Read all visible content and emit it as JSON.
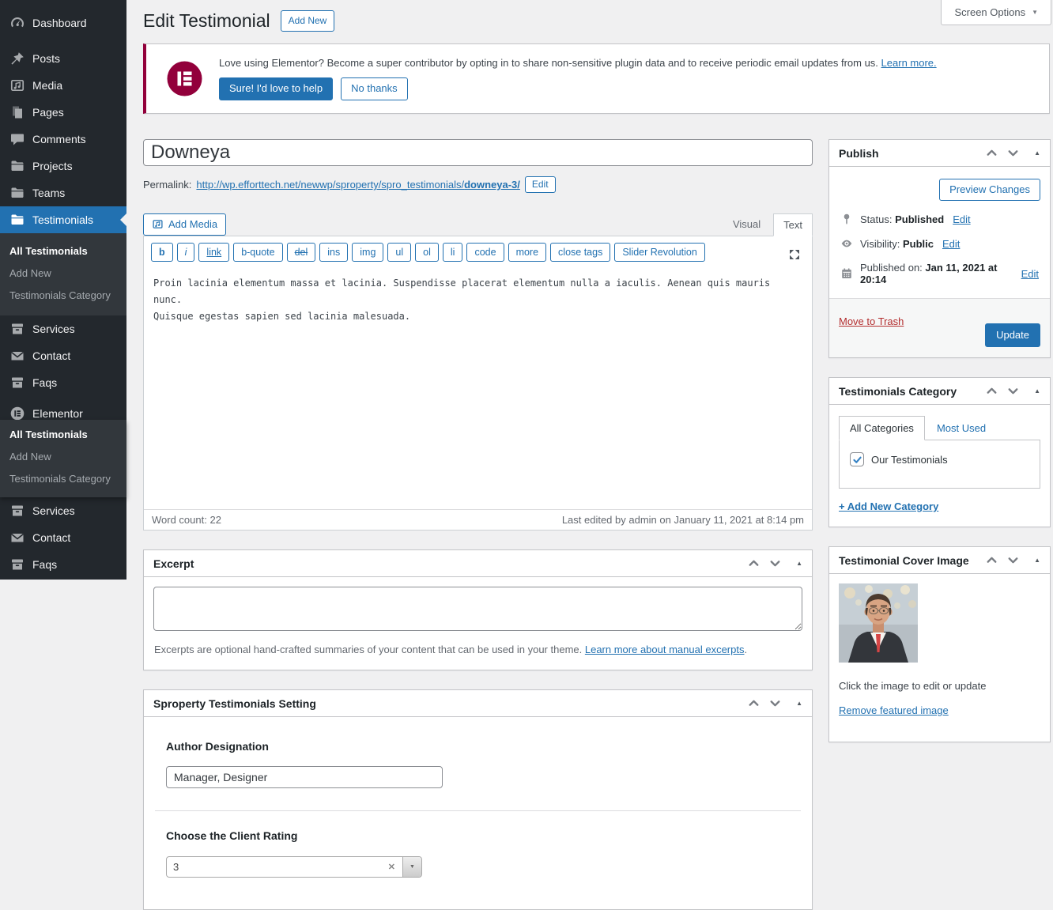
{
  "screen_options": {
    "label": "Screen Options"
  },
  "sidebar": {
    "dashboard": "Dashboard",
    "posts": "Posts",
    "media": "Media",
    "pages": "Pages",
    "comments": "Comments",
    "projects": "Projects",
    "teams": "Teams",
    "testimonials": "Testimonials",
    "submenu": {
      "all": "All Testimonials",
      "add": "Add New",
      "category": "Testimonials Category"
    },
    "services": "Services",
    "contact": "Contact",
    "faqs": "Faqs",
    "elementor": "Elementor",
    "flyout": {
      "all": "All Testimonials",
      "add": "Add New",
      "category": "Testimonials Category"
    },
    "services2": "Services",
    "contact2": "Contact",
    "faqs2": "Faqs"
  },
  "header": {
    "title": "Edit Testimonial",
    "add_new": "Add New"
  },
  "notice": {
    "message": "Love using Elementor? Become a super contributor by opting in to share non-sensitive plugin data and to receive periodic email updates from us. ",
    "learn_more": "Learn more.",
    "accept": "Sure! I'd love to help",
    "decline": "No thanks"
  },
  "post": {
    "title": "Downeya",
    "permalink_label": "Permalink:",
    "permalink_base": "http://wp.efforttech.net/newwp/sproperty/spro_testimonials/",
    "permalink_slug": "downeya-3/",
    "edit_button": "Edit"
  },
  "editor": {
    "add_media": "Add Media",
    "visual_tab": "Visual",
    "text_tab": "Text",
    "quicktags": [
      "b",
      "i",
      "link",
      "b-quote",
      "del",
      "ins",
      "img",
      "ul",
      "ol",
      "li",
      "code",
      "more",
      "close tags",
      "Slider Revolution"
    ],
    "content": "Proin lacinia elementum massa et lacinia. Suspendisse placerat elementum nulla a iaculis. Aenean quis mauris nunc.\nQuisque egestas sapien sed lacinia malesuada.",
    "word_count": "Word count: 22",
    "last_edited": "Last edited by admin on January 11, 2021 at 8:14 pm"
  },
  "excerpt": {
    "title": "Excerpt",
    "help_text": "Excerpts are optional hand-crafted summaries of your content that can be used in your theme. ",
    "help_link": "Learn more about manual excerpts",
    "help_period": "."
  },
  "settings": {
    "title": "Sproperty Testimonials Setting",
    "author_label": "Author Designation",
    "author_value": "Manager, Designer",
    "rating_label": "Choose the Client Rating",
    "rating_value": "3"
  },
  "publish": {
    "title": "Publish",
    "preview": "Preview Changes",
    "status_label": "Status:",
    "status_value": "Published",
    "visibility_label": "Visibility:",
    "visibility_value": "Public",
    "published_label": "Published on:",
    "published_value": "Jan 11, 2021 at 20:14",
    "edit": "Edit",
    "trash": "Move to Trash",
    "update": "Update"
  },
  "category_box": {
    "title": "Testimonials Category",
    "tab_all": "All Categories",
    "tab_most_used": "Most Used",
    "item": "Our Testimonials",
    "add_new": "+ Add New Category"
  },
  "cover_box": {
    "title": "Testimonial Cover Image",
    "hint": "Click the image to edit or update",
    "remove": "Remove featured image"
  },
  "colors": {
    "accent": "#2271b1",
    "elementor_brand": "#92003b",
    "sidebar_bg": "#23282d",
    "submenu_bg": "#32373c",
    "trash_red": "#b32d2e"
  }
}
